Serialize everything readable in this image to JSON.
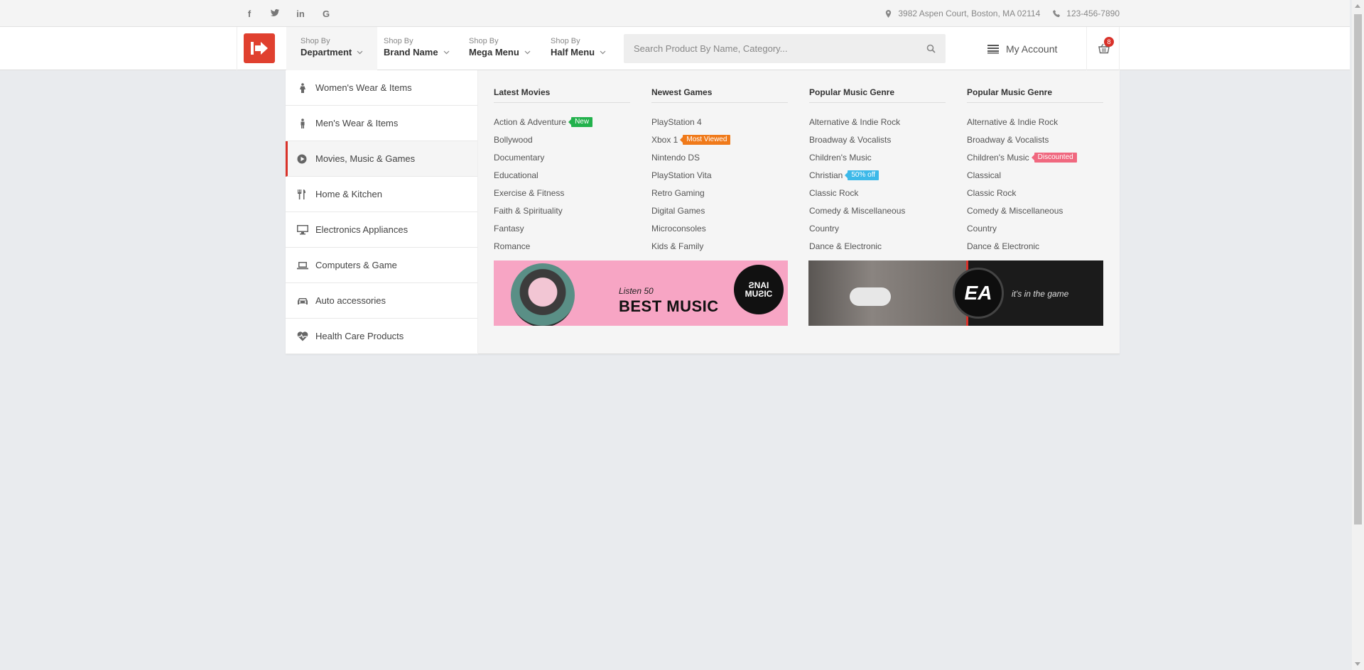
{
  "topbar": {
    "socials": [
      {
        "icon": "facebook-icon",
        "glyph": "f"
      },
      {
        "icon": "twitter-icon",
        "glyph": "t"
      },
      {
        "icon": "linkedin-icon",
        "glyph": "in"
      },
      {
        "icon": "google-icon",
        "glyph": "G"
      }
    ],
    "address": "3982 Aspen Court, Boston, MA 02114",
    "phone": "123-456-7890"
  },
  "header": {
    "nav": [
      {
        "small": "Shop By",
        "big": "Department"
      },
      {
        "small": "Shop By",
        "big": "Brand Name"
      },
      {
        "small": "Shop By",
        "big": "Mega Menu"
      },
      {
        "small": "Shop By",
        "big": "Half Menu"
      }
    ],
    "search_placeholder": "Search Product By Name, Category...",
    "account_label": "My Account",
    "cart_count": "8"
  },
  "sidebar": {
    "items": [
      {
        "label": "Women's Wear & Items",
        "icon": "female-icon"
      },
      {
        "label": "Men's Wear & Items",
        "icon": "male-icon"
      },
      {
        "label": "Movies, Music & Games",
        "icon": "play-circle-icon"
      },
      {
        "label": "Home & Kitchen",
        "icon": "cutlery-icon"
      },
      {
        "label": "Electronics Appliances",
        "icon": "desktop-icon"
      },
      {
        "label": "Computers & Game",
        "icon": "laptop-icon"
      },
      {
        "label": "Auto accessories",
        "icon": "car-icon"
      },
      {
        "label": "Health Care Products",
        "icon": "heartbeat-icon"
      }
    ],
    "active_index": 2
  },
  "columns": [
    {
      "title": "Latest Movies",
      "items": [
        {
          "label": "Action & Adventure",
          "tag": "New",
          "tag_color": "#22b14c"
        },
        {
          "label": "Bollywood"
        },
        {
          "label": "Documentary"
        },
        {
          "label": "Educational"
        },
        {
          "label": "Exercise & Fitness"
        },
        {
          "label": "Faith & Spirituality"
        },
        {
          "label": "Fantasy"
        },
        {
          "label": "Romance"
        }
      ]
    },
    {
      "title": "Newest Games",
      "items": [
        {
          "label": "PlayStation 4"
        },
        {
          "label": "Xbox 1",
          "tag": "Most Viewed",
          "tag_color": "#f07a1a"
        },
        {
          "label": "Nintendo DS"
        },
        {
          "label": "PlayStation Vita"
        },
        {
          "label": "Retro Gaming"
        },
        {
          "label": "Digital Games"
        },
        {
          "label": "Microconsoles"
        },
        {
          "label": "Kids & Family"
        }
      ]
    },
    {
      "title": "Popular Music Genre",
      "items": [
        {
          "label": "Alternative & Indie Rock"
        },
        {
          "label": "Broadway & Vocalists"
        },
        {
          "label": "Children's Music"
        },
        {
          "label": "Christian",
          "tag": "50% off",
          "tag_color": "#3db9e9"
        },
        {
          "label": "Classic Rock"
        },
        {
          "label": "Comedy & Miscellaneous"
        },
        {
          "label": "Country"
        },
        {
          "label": "Dance & Electronic"
        }
      ]
    },
    {
      "title": "Popular Music Genre",
      "items": [
        {
          "label": "Alternative & Indie Rock"
        },
        {
          "label": "Broadway & Vocalists"
        },
        {
          "label": "Children's Music",
          "tag": "Discounted",
          "tag_color": "#f0687f"
        },
        {
          "label": "Classical"
        },
        {
          "label": "Classic Rock"
        },
        {
          "label": "Comedy & Miscellaneous"
        },
        {
          "label": "Country"
        },
        {
          "label": "Dance & Electronic"
        }
      ]
    }
  ],
  "banners": {
    "music": {
      "listen": "Listen 50",
      "headline": "BEST MUSIC",
      "disc_text": "ƧNAI MUƧIC"
    },
    "ea": {
      "logo": "EA",
      "slogan": "it's in the game"
    }
  },
  "colors": {
    "accent": "#d9322a",
    "logo_bg": "#e0402f"
  }
}
